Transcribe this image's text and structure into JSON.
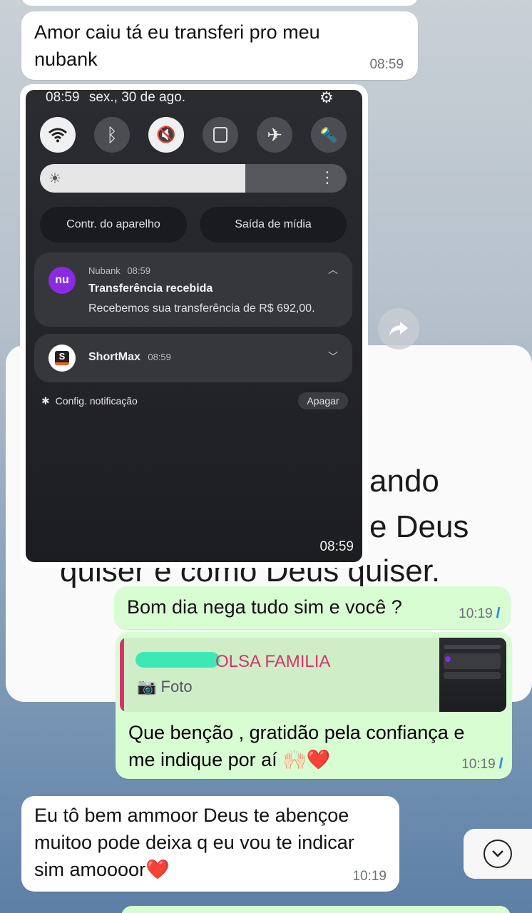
{
  "messages": {
    "m1": {
      "text_line1": "Amor caiu tá eu transferi pro meu",
      "text_line2": "nubank",
      "time": "08:59"
    },
    "m2": {
      "text": "Bom dia nega tudo sim e você ?",
      "time": "10:19"
    },
    "m3": {
      "reply_sender": "BOLSA FAMILIA",
      "reply_sender_visible": "OLSA FAMILIA",
      "reply_type": "Foto",
      "text_line1": "Que benção , gratidão pela confiança e",
      "text_line2": "me indique por aí 🙌🏻❤️",
      "time": "10:19"
    },
    "m4": {
      "text_line1": "Eu tô bem ammoor Deus te abençoe",
      "text_line2": "muitoo pode deixa q eu vou te indicar",
      "text_line3": "sim amoooor❤️",
      "time": "10:19"
    }
  },
  "poster": {
    "line1": "ando",
    "line2": "e Deus",
    "line3": "quiser e como Deus quiser."
  },
  "screenshot": {
    "status_time": "08:59",
    "status_date": "sex., 30 de ago.",
    "device_controls": "Contr. do aparelho",
    "media_output": "Saída de mídia",
    "notif1": {
      "app": "Nubank",
      "time": "08:59",
      "title": "Transferência recebida",
      "body": "Recebemos sua transferência de R$ 692,00.",
      "badge": "nu"
    },
    "notif2": {
      "app": "ShortMax",
      "time": "08:59",
      "badge": "S"
    },
    "notif_settings": "Config. notificação",
    "clear": "Apagar",
    "bottom_time": "08:59"
  },
  "colors": {
    "out_bubble": "#d9fdd3",
    "in_bubble": "#ffffff",
    "read_ticks": "#2f8fe8",
    "reply_accent": "#d6336c",
    "nubank": "#8a2be2"
  }
}
